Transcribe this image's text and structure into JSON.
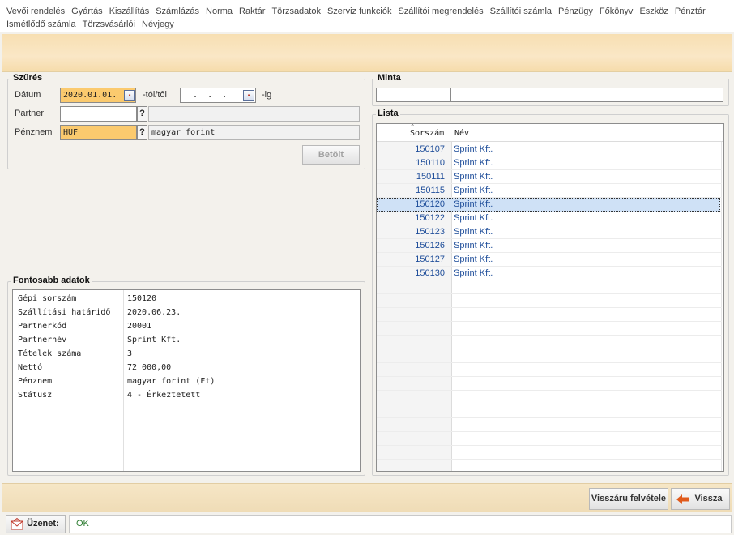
{
  "menu": {
    "row1": [
      "Vevői rendelés",
      "Gyártás",
      "Kiszállítás",
      "Számlázás",
      "Norma",
      "Raktár",
      "Törzsadatok",
      "Szerviz funkciók",
      "Szállítói megrendelés",
      "Szállítói számla",
      "Pénzügy",
      "Főkönyv",
      "Eszköz",
      "Pénztár"
    ],
    "row2": [
      "Ismétlődő számla",
      "Törzsvásárlói",
      "Névjegy"
    ]
  },
  "filter": {
    "title": "Szűrés",
    "date_label": "Dátum",
    "date_from": "2020.01.01.",
    "from_suffix": "-tól/től",
    "date_to": "  .  .  .",
    "to_suffix": "-ig",
    "partner_label": "Partner",
    "partner_value": "",
    "partner_name": "",
    "currency_label": "Pénznem",
    "currency_code": "HUF",
    "currency_name": "magyar forint",
    "lookup_label": "?",
    "load_button": "Betölt"
  },
  "details": {
    "title": "Fontosabb adatok",
    "rows": [
      {
        "key": "Gépi sorszám",
        "value": "150120"
      },
      {
        "key": "Szállítási határidő",
        "value": "2020.06.23."
      },
      {
        "key": "Partnerkód",
        "value": "20001"
      },
      {
        "key": "Partnernév",
        "value": "Sprint Kft."
      },
      {
        "key": "Tételek száma",
        "value": "3"
      },
      {
        "key": "Nettó",
        "value": "72 000,00"
      },
      {
        "key": "Pénznem",
        "value": "magyar forint (Ft)"
      },
      {
        "key": "Státusz",
        "value": "4 - Érkeztetett"
      }
    ]
  },
  "minta": {
    "title": "Minta",
    "field1": "",
    "field2": ""
  },
  "lista": {
    "title": "Lista",
    "columns": [
      "Sorszám",
      "Név"
    ],
    "sort_indicator": "^",
    "selected_index": 4,
    "rows": [
      {
        "num": "150107",
        "name": "Sprint Kft."
      },
      {
        "num": "150110",
        "name": "Sprint Kft."
      },
      {
        "num": "150111",
        "name": "Sprint Kft."
      },
      {
        "num": "150115",
        "name": "Sprint Kft."
      },
      {
        "num": "150120",
        "name": "Sprint Kft."
      },
      {
        "num": "150122",
        "name": "Sprint Kft."
      },
      {
        "num": "150123",
        "name": "Sprint Kft."
      },
      {
        "num": "150126",
        "name": "Sprint Kft."
      },
      {
        "num": "150127",
        "name": "Sprint Kft."
      },
      {
        "num": "150130",
        "name": "Sprint Kft."
      }
    ]
  },
  "actions": {
    "return_receipt": "Visszáru felvétele",
    "back": "Vissza"
  },
  "status": {
    "label": "Üzenet:",
    "message": "OK",
    "message_color": "#2e7d32"
  },
  "colors": {
    "accent_orange": "#fbca6e",
    "selection": "#cfe1f6",
    "link_blue": "#1f4e9a",
    "back_arrow": "#e05a1b"
  }
}
